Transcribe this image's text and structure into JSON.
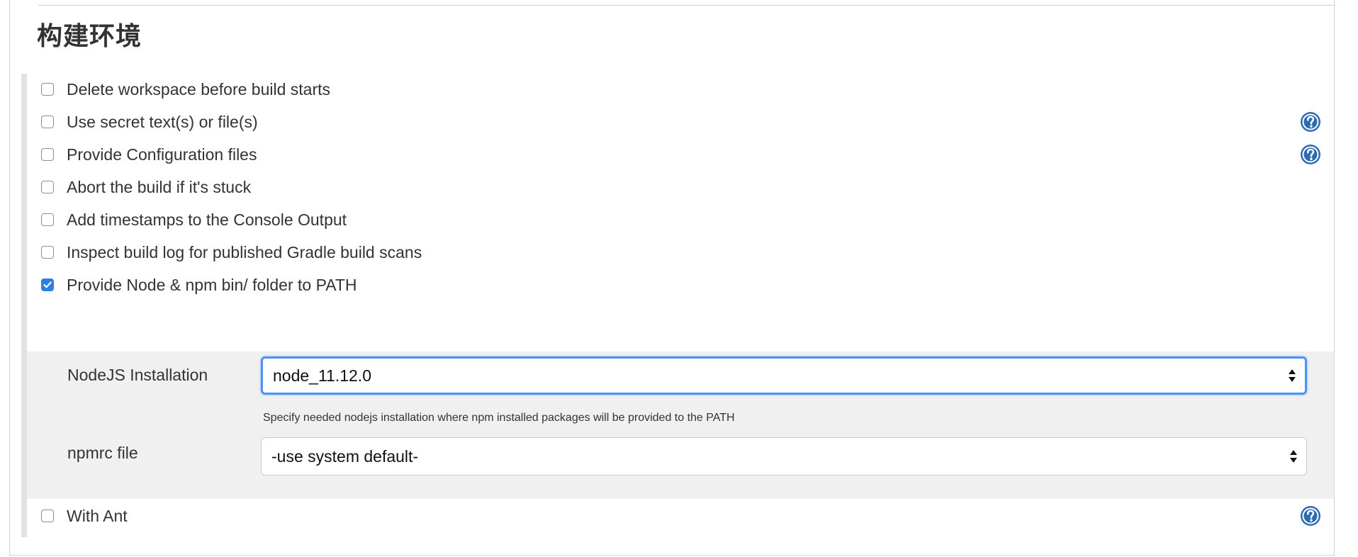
{
  "section": {
    "title": "构建环境"
  },
  "options": [
    {
      "label": "Delete workspace before build starts",
      "checked": false,
      "help": false
    },
    {
      "label": "Use secret text(s) or file(s)",
      "checked": false,
      "help": true
    },
    {
      "label": "Provide Configuration files",
      "checked": false,
      "help": true
    },
    {
      "label": "Abort the build if it's stuck",
      "checked": false,
      "help": false
    },
    {
      "label": "Add timestamps to the Console Output",
      "checked": false,
      "help": false
    },
    {
      "label": "Inspect build log for published Gradle build scans",
      "checked": false,
      "help": false
    },
    {
      "label": "Provide Node & npm bin/ folder to PATH",
      "checked": true,
      "help": false
    },
    {
      "label": "With Ant",
      "checked": false,
      "help": true
    }
  ],
  "node_config": {
    "nodejs_label": "NodeJS Installation",
    "nodejs_value": "node_11.12.0",
    "nodejs_hint": "Specify needed nodejs installation where npm installed packages will be provided to the PATH",
    "npmrc_label": "npmrc file",
    "npmrc_value": "-use system default-"
  },
  "icons": {
    "help": "help-question-icon",
    "checkbox_checked": "checkmark-icon",
    "select_arrows": "up-down-arrows-icon"
  },
  "colors": {
    "accent": "#2d7fe0",
    "focus_ring": "#4d90fe",
    "help_icon": "#2c6bb1",
    "sub_block_bg": "#f0f0f0"
  }
}
